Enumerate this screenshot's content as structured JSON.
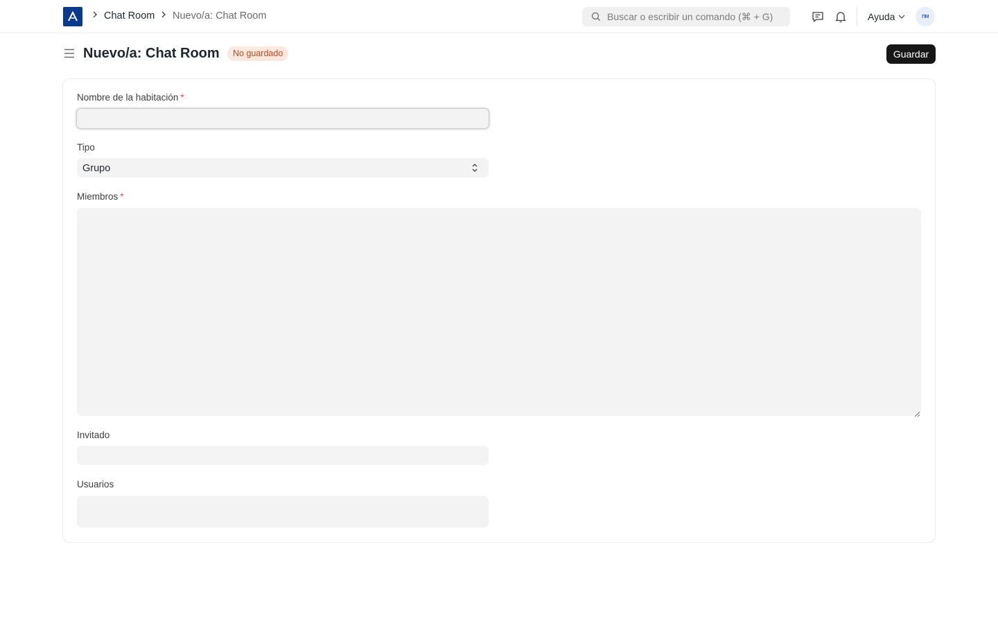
{
  "breadcrumb": {
    "items": [
      "Chat Room",
      "Nuevo/a: Chat Room"
    ]
  },
  "search": {
    "placeholder": "Buscar o escribir un comando (⌘ + G)"
  },
  "navbar": {
    "help_label": "Ayuda",
    "avatar_initials": "ПМ",
    "icons": [
      "chat-icon",
      "bell-icon",
      "chevron-down-icon"
    ]
  },
  "page": {
    "title": "Nuevo/a: Chat Room",
    "status_badge": "No guardado",
    "save_label": "Guardar"
  },
  "form": {
    "room_name": {
      "label": "Nombre de la habitación",
      "required_mark": "*",
      "value": ""
    },
    "type": {
      "label": "Tipo",
      "value": "Grupo"
    },
    "members": {
      "label": "Miembros",
      "required_mark": "*",
      "value": ""
    },
    "guest": {
      "label": "Invitado",
      "value": ""
    },
    "users": {
      "label": "Usuarios",
      "value": ""
    }
  },
  "colors": {
    "accent": "#171717",
    "badge_bg": "#fde8de",
    "badge_text": "#c0471b",
    "logo": "#0b3a8c",
    "required": "#e24c4c"
  }
}
